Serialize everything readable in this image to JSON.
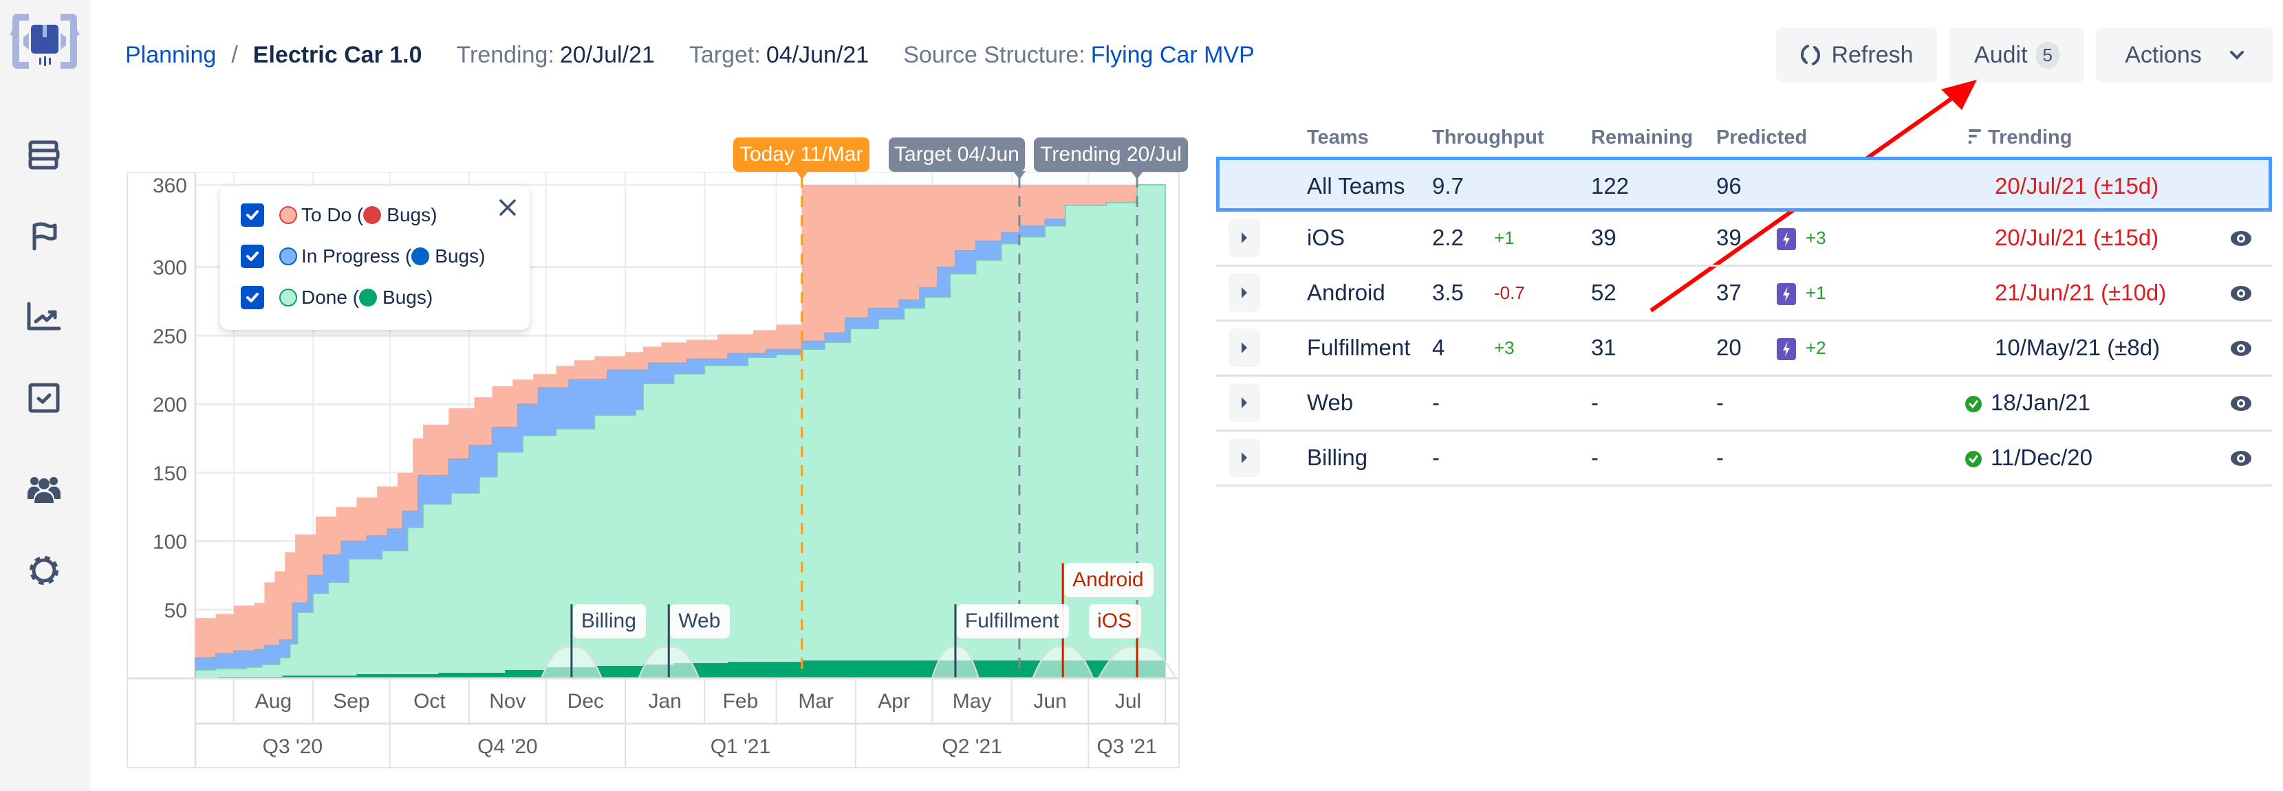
{
  "sidebar": {
    "items": [
      {
        "name": "backlog",
        "icon": "stack-icon"
      },
      {
        "name": "milestones",
        "icon": "flag-icon"
      },
      {
        "name": "reports",
        "icon": "trend-chart-icon"
      },
      {
        "name": "tasks",
        "icon": "checkbox-icon"
      },
      {
        "name": "teams",
        "icon": "users-icon"
      },
      {
        "name": "settings",
        "icon": "gear-icon"
      }
    ]
  },
  "header": {
    "breadcrumb_root": "Planning",
    "breadcrumb_sep": "/",
    "breadcrumb_current": "Electric Car 1.0",
    "trending_label": "Trending:",
    "trending_value": "20/Jul/21",
    "target_label": "Target:",
    "target_value": "04/Jun/21",
    "source_label": "Source Structure:",
    "source_value": "Flying Car MVP"
  },
  "toolbar": {
    "refresh_label": "Refresh",
    "audit_label": "Audit",
    "audit_count": "5",
    "actions_label": "Actions"
  },
  "chart_data": {
    "type": "area",
    "title": "",
    "xlabel": "",
    "ylabel": "",
    "stacked": true,
    "ylim": [
      0,
      360
    ],
    "yticks": [
      50,
      100,
      150,
      200,
      250,
      300,
      360
    ],
    "x_range": [
      "2020-07-17",
      "2021-07-31"
    ],
    "month_ticks": [
      "Aug",
      "Sep",
      "Oct",
      "Nov",
      "Dec",
      "Jan",
      "Feb",
      "Mar",
      "Apr",
      "May",
      "Jun",
      "Jul"
    ],
    "quarter_ticks": [
      "Q3 '20",
      "Q4 '20",
      "Q1 '21",
      "Q2 '21",
      "Q3 '21"
    ],
    "grid": true,
    "legend": {
      "placement": "top-left",
      "entries": [
        {
          "label": "To Do",
          "bugs_label": "Bugs",
          "color": "#fbb5a3",
          "bug_color": "#d9413d",
          "checked": true
        },
        {
          "label": "In Progress",
          "bugs_label": "Bugs",
          "color": "#7fb2fa",
          "bug_color": "#0065c9",
          "checked": true
        },
        {
          "label": "Done",
          "bugs_label": "Bugs",
          "color": "#b3f0d8",
          "bug_color": "#00a66e",
          "checked": true
        }
      ]
    },
    "series": [
      {
        "name": "Total (To Do top)",
        "color": "#fbb5a3",
        "points": [
          [
            "2020-07-17",
            44
          ],
          [
            "2020-07-25",
            47
          ],
          [
            "2020-08-01",
            53
          ],
          [
            "2020-08-09",
            55
          ],
          [
            "2020-08-13",
            70
          ],
          [
            "2020-08-17",
            78
          ],
          [
            "2020-08-21",
            92
          ],
          [
            "2020-08-25",
            105
          ],
          [
            "2020-09-02",
            118
          ],
          [
            "2020-09-10",
            125
          ],
          [
            "2020-09-18",
            132
          ],
          [
            "2020-09-26",
            140
          ],
          [
            "2020-10-04",
            150
          ],
          [
            "2020-10-10",
            175
          ],
          [
            "2020-10-14",
            185
          ],
          [
            "2020-10-24",
            197
          ],
          [
            "2020-11-03",
            205
          ],
          [
            "2020-11-10",
            213
          ],
          [
            "2020-11-18",
            218
          ],
          [
            "2020-11-26",
            222
          ],
          [
            "2020-12-05",
            228
          ],
          [
            "2020-12-12",
            232
          ],
          [
            "2020-12-20",
            235
          ],
          [
            "2021-01-01",
            238
          ],
          [
            "2021-01-08",
            242
          ],
          [
            "2021-01-15",
            245
          ],
          [
            "2021-01-25",
            247
          ],
          [
            "2021-02-06",
            251
          ],
          [
            "2021-02-20",
            254
          ],
          [
            "2021-03-01",
            258
          ],
          [
            "2021-03-11",
            258
          ],
          [
            "2021-03-11",
            360
          ],
          [
            "2021-07-31",
            360
          ]
        ]
      },
      {
        "name": "In Progress top",
        "color": "#7fb2fa",
        "points": [
          [
            "2020-07-17",
            15
          ],
          [
            "2020-07-25",
            18
          ],
          [
            "2020-08-01",
            20
          ],
          [
            "2020-08-09",
            21
          ],
          [
            "2020-08-13",
            24
          ],
          [
            "2020-08-19",
            28
          ],
          [
            "2020-08-24",
            55
          ],
          [
            "2020-08-30",
            75
          ],
          [
            "2020-09-05",
            90
          ],
          [
            "2020-09-12",
            100
          ],
          [
            "2020-09-22",
            104
          ],
          [
            "2020-09-30",
            109
          ],
          [
            "2020-10-06",
            122
          ],
          [
            "2020-10-12",
            148
          ],
          [
            "2020-10-24",
            160
          ],
          [
            "2020-11-01",
            170
          ],
          [
            "2020-11-10",
            183
          ],
          [
            "2020-11-20",
            200
          ],
          [
            "2020-11-28",
            212
          ],
          [
            "2020-12-10",
            218
          ],
          [
            "2020-12-25",
            225
          ],
          [
            "2021-01-10",
            230
          ],
          [
            "2021-01-25",
            233
          ],
          [
            "2021-02-10",
            237
          ],
          [
            "2021-02-25",
            240
          ],
          [
            "2021-03-11",
            246
          ],
          [
            "2021-03-20",
            252
          ],
          [
            "2021-03-28",
            263
          ],
          [
            "2021-04-06",
            270
          ],
          [
            "2021-04-18",
            276
          ],
          [
            "2021-04-26",
            285
          ],
          [
            "2021-05-03",
            300
          ],
          [
            "2021-05-10",
            312
          ],
          [
            "2021-05-18",
            319
          ],
          [
            "2021-05-28",
            325
          ],
          [
            "2021-06-04",
            330
          ],
          [
            "2021-06-14",
            335
          ],
          [
            "2021-06-22",
            345
          ],
          [
            "2021-07-08",
            347
          ],
          [
            "2021-07-20",
            360
          ],
          [
            "2021-07-31",
            360
          ]
        ]
      },
      {
        "name": "Done top",
        "color": "#b3f0d8",
        "points": [
          [
            "2020-07-17",
            6
          ],
          [
            "2020-07-25",
            7
          ],
          [
            "2020-08-06",
            8
          ],
          [
            "2020-08-12",
            10
          ],
          [
            "2020-08-19",
            15
          ],
          [
            "2020-08-23",
            25
          ],
          [
            "2020-08-26",
            48
          ],
          [
            "2020-09-01",
            62
          ],
          [
            "2020-09-07",
            70
          ],
          [
            "2020-09-15",
            87
          ],
          [
            "2020-09-28",
            93
          ],
          [
            "2020-10-08",
            110
          ],
          [
            "2020-10-14",
            127
          ],
          [
            "2020-10-25",
            135
          ],
          [
            "2020-11-05",
            147
          ],
          [
            "2020-11-12",
            165
          ],
          [
            "2020-11-22",
            177
          ],
          [
            "2020-12-05",
            182
          ],
          [
            "2020-12-20",
            192
          ],
          [
            "2021-01-05",
            196
          ],
          [
            "2021-01-08",
            215
          ],
          [
            "2021-01-20",
            222
          ],
          [
            "2021-02-01",
            228
          ],
          [
            "2021-02-18",
            234
          ],
          [
            "2021-03-01",
            236
          ],
          [
            "2021-03-11",
            240
          ],
          [
            "2021-03-20",
            245
          ],
          [
            "2021-03-30",
            255
          ],
          [
            "2021-04-10",
            262
          ],
          [
            "2021-04-20",
            270
          ],
          [
            "2021-04-28",
            278
          ],
          [
            "2021-05-08",
            295
          ],
          [
            "2021-05-18",
            305
          ],
          [
            "2021-05-28",
            317
          ],
          [
            "2021-06-04",
            322
          ],
          [
            "2021-06-14",
            330
          ],
          [
            "2021-06-22",
            345
          ],
          [
            "2021-07-08",
            347
          ],
          [
            "2021-07-20",
            360
          ],
          [
            "2021-07-31",
            360
          ]
        ]
      },
      {
        "name": "Done Bugs",
        "color": "#00a66e",
        "points": [
          [
            "2020-07-17",
            0
          ],
          [
            "2020-07-26",
            1
          ],
          [
            "2020-08-20",
            2
          ],
          [
            "2020-09-18",
            3
          ],
          [
            "2020-10-20",
            4
          ],
          [
            "2020-11-15",
            6
          ],
          [
            "2020-12-01",
            8
          ],
          [
            "2020-12-20",
            9
          ],
          [
            "2021-01-08",
            10
          ],
          [
            "2021-01-20",
            11
          ],
          [
            "2021-02-10",
            12
          ],
          [
            "2021-03-11",
            13
          ],
          [
            "2021-07-31",
            13
          ]
        ]
      }
    ],
    "annotations": {
      "top_markers": [
        {
          "label": "Today 11/Mar",
          "date": "2021-03-11",
          "color": "#ff991f"
        },
        {
          "label": "Target 04/Jun",
          "date": "2021-06-04",
          "color": "#7a869a"
        },
        {
          "label": "Trending 20/Jul",
          "date": "2021-07-20",
          "color": "#7a869a"
        }
      ],
      "team_markers": [
        {
          "label": "Billing",
          "date": "2020-12-11",
          "level": 40,
          "color": "#344563",
          "text_color": "#344563"
        },
        {
          "label": "Web",
          "date": "2021-01-18",
          "level": 40,
          "color": "#344563",
          "text_color": "#344563"
        },
        {
          "label": "Fulfillment",
          "date": "2021-05-10",
          "level": 40,
          "color": "#344563",
          "text_color": "#344563"
        },
        {
          "label": "Android",
          "date": "2021-06-21",
          "level": 70,
          "color": "#bf2600",
          "text_color": "#bf2600"
        },
        {
          "label": "iOS",
          "date": "2021-07-20",
          "level": 40,
          "color": "#bf2600",
          "text_color": "#bf2600"
        }
      ]
    }
  },
  "table": {
    "columns": [
      "Teams",
      "Throughput",
      "Remaining",
      "Predicted",
      "Trending"
    ],
    "rows": [
      {
        "team": "All Teams",
        "throughput": "9.7",
        "throughput_delta": "",
        "remaining": "122",
        "predicted": "96",
        "predicted_delta": "",
        "trending": "20/Jul/21 (±15d)",
        "trending_status": "late",
        "selected": true
      },
      {
        "team": "iOS",
        "throughput": "2.2",
        "throughput_delta": "+1",
        "remaining": "39",
        "predicted": "39",
        "predicted_delta": "+3",
        "trending": "20/Jul/21 (±15d)",
        "trending_status": "late"
      },
      {
        "team": "Android",
        "throughput": "3.5",
        "throughput_delta": "-0.7",
        "remaining": "52",
        "predicted": "37",
        "predicted_delta": "+1",
        "trending": "21/Jun/21 (±10d)",
        "trending_status": "late"
      },
      {
        "team": "Fulfillment",
        "throughput": "4",
        "throughput_delta": "+3",
        "remaining": "31",
        "predicted": "20",
        "predicted_delta": "+2",
        "trending": "10/May/21 (±8d)",
        "trending_status": "ok"
      },
      {
        "team": "Web",
        "throughput": "-",
        "throughput_delta": "",
        "remaining": "-",
        "predicted": "-",
        "predicted_delta": "",
        "trending": "18/Jan/21",
        "trending_status": "done"
      },
      {
        "team": "Billing",
        "throughput": "-",
        "throughput_delta": "",
        "remaining": "-",
        "predicted": "-",
        "predicted_delta": "",
        "trending": "11/Dec/20",
        "trending_status": "done"
      }
    ]
  }
}
